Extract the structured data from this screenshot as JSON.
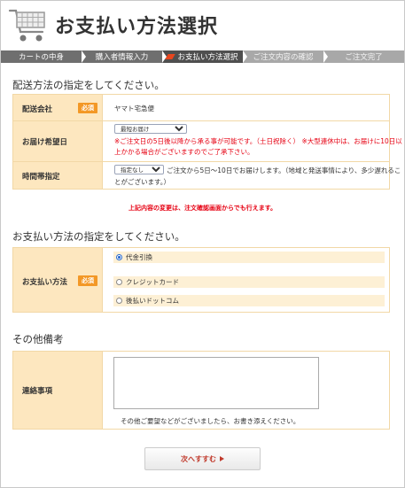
{
  "header": {
    "title": "お支払い方法選択"
  },
  "steps": [
    {
      "label": "カートの中身"
    },
    {
      "label": "購入者情報入力"
    },
    {
      "label": "お支払い方法選択"
    },
    {
      "label": "ご注文内容の確認"
    },
    {
      "label": "ご注文完了"
    }
  ],
  "delivery": {
    "section_title": "配送方法の指定をしてください。",
    "required_label": "必須",
    "company_label": "配送会社",
    "company_value": "ヤマト宅急便",
    "date_label": "お届け希望日",
    "date_select": "最短お届け",
    "date_note_1": "※ご注文日の5日後以降から承る事が可能です。（土日祝除く）  ※大型連休中は、お届けに10日以",
    "date_note_2": "上かかる場合がございますのでご了承下さい。",
    "time_label": "時間帯指定",
    "time_select": "指定なし",
    "time_note_1": "ご注文から5日〜10日でお届けします。（地域と発送事情により、多少遅れるこ",
    "time_note_2": "とがございます。）"
  },
  "change_note": "上記内容の変更は、注文確認画面からでも行えます。",
  "payment": {
    "section_title": "お支払い方法の指定をしてください。",
    "label": "お支払い方法",
    "required_label": "必須",
    "options": [
      {
        "label": "代金引換",
        "selected": true
      },
      {
        "label": "クレジットカード",
        "selected": false
      },
      {
        "label": "後払いドットコム",
        "selected": false
      }
    ]
  },
  "other": {
    "section_title": "その他備考",
    "label": "連絡事項",
    "note": "その他ご要望などがございましたら、お書き添えください。"
  },
  "next_button": "次へすすむ"
}
